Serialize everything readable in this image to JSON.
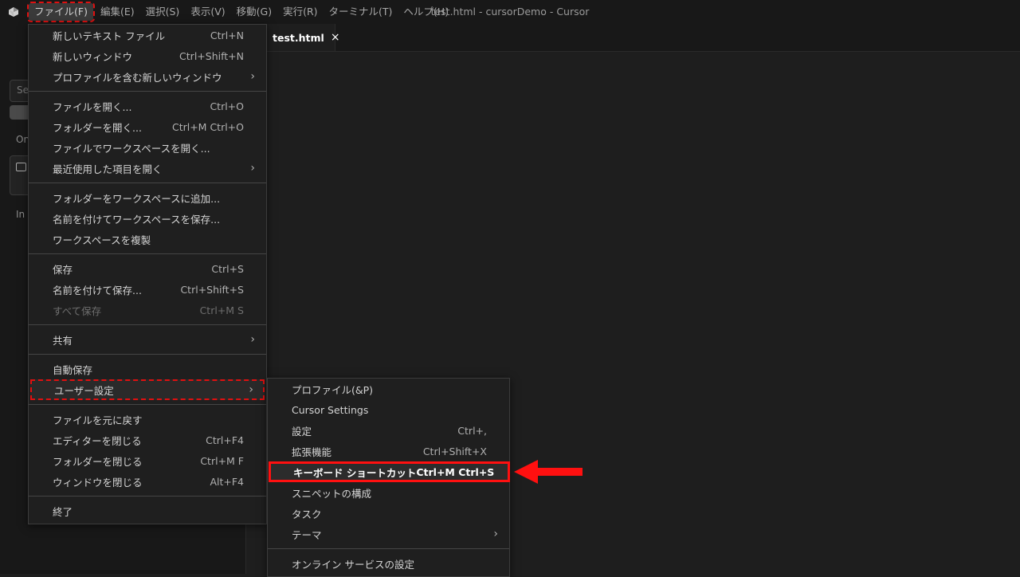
{
  "window": {
    "title": "test.html - cursorDemo - Cursor"
  },
  "menubar": [
    {
      "label": "ファイル(F)"
    },
    {
      "label": "編集(E)"
    },
    {
      "label": "選択(S)"
    },
    {
      "label": "表示(V)"
    },
    {
      "label": "移動(G)"
    },
    {
      "label": "実行(R)"
    },
    {
      "label": "ターミナル(T)"
    },
    {
      "label": "ヘルプ(H)"
    }
  ],
  "sidebar": {
    "search_placeholder": "Se",
    "text1": "On",
    "text2": "In"
  },
  "tab": {
    "label": "test.html",
    "close": "×"
  },
  "file_menu": {
    "groups": [
      [
        {
          "label": "新しいテキスト ファイル",
          "key": "Ctrl+N"
        },
        {
          "label": "新しいウィンドウ",
          "key": "Ctrl+Shift+N"
        },
        {
          "label": "プロファイルを含む新しいウィンドウ",
          "key": "",
          "submenu": true
        }
      ],
      [
        {
          "label": "ファイルを開く...",
          "key": "Ctrl+O"
        },
        {
          "label": "フォルダーを開く...",
          "key": "Ctrl+M Ctrl+O"
        },
        {
          "label": "ファイルでワークスペースを開く...",
          "key": ""
        },
        {
          "label": "最近使用した項目を開く",
          "key": "",
          "submenu": true
        }
      ],
      [
        {
          "label": "フォルダーをワークスペースに追加...",
          "key": ""
        },
        {
          "label": "名前を付けてワークスペースを保存...",
          "key": ""
        },
        {
          "label": "ワークスペースを複製",
          "key": ""
        }
      ],
      [
        {
          "label": "保存",
          "key": "Ctrl+S"
        },
        {
          "label": "名前を付けて保存...",
          "key": "Ctrl+Shift+S"
        },
        {
          "label": "すべて保存",
          "key": "Ctrl+M S",
          "disabled": true
        }
      ],
      [
        {
          "label": "共有",
          "key": "",
          "submenu": true
        }
      ],
      [
        {
          "label": "自動保存",
          "key": ""
        },
        {
          "label": "ユーザー設定",
          "key": "",
          "submenu": true,
          "selected": true
        }
      ],
      [
        {
          "label": "ファイルを元に戻す",
          "key": ""
        },
        {
          "label": "エディターを閉じる",
          "key": "Ctrl+F4"
        },
        {
          "label": "フォルダーを閉じる",
          "key": "Ctrl+M F"
        },
        {
          "label": "ウィンドウを閉じる",
          "key": "Alt+F4"
        }
      ],
      [
        {
          "label": "終了",
          "key": ""
        }
      ]
    ]
  },
  "user_menu": {
    "groups": [
      [
        {
          "label": "プロファイル(&P)",
          "key": ""
        },
        {
          "label": "Cursor Settings",
          "key": ""
        },
        {
          "label": "設定",
          "key": "Ctrl+,"
        },
        {
          "label": "拡張機能",
          "key": "Ctrl+Shift+X"
        },
        {
          "label": "キーボード ショートカット",
          "key": "Ctrl+M Ctrl+S",
          "highlight": true
        },
        {
          "label": "スニペットの構成",
          "key": ""
        },
        {
          "label": "タスク",
          "key": ""
        },
        {
          "label": "テーマ",
          "key": "",
          "submenu": true
        }
      ],
      [
        {
          "label": "オンライン サービスの設定",
          "key": ""
        }
      ]
    ]
  },
  "colors": {
    "annotation": "#ff1010",
    "menu_bg": "#1f1f1f",
    "bar_bg": "#181818",
    "editor_bg": "#1e1e1e"
  },
  "icons": {
    "app_logo": "cursor-logo-icon",
    "submenu": "chevron-right-icon",
    "annotation": "red-arrow-left-icon"
  }
}
